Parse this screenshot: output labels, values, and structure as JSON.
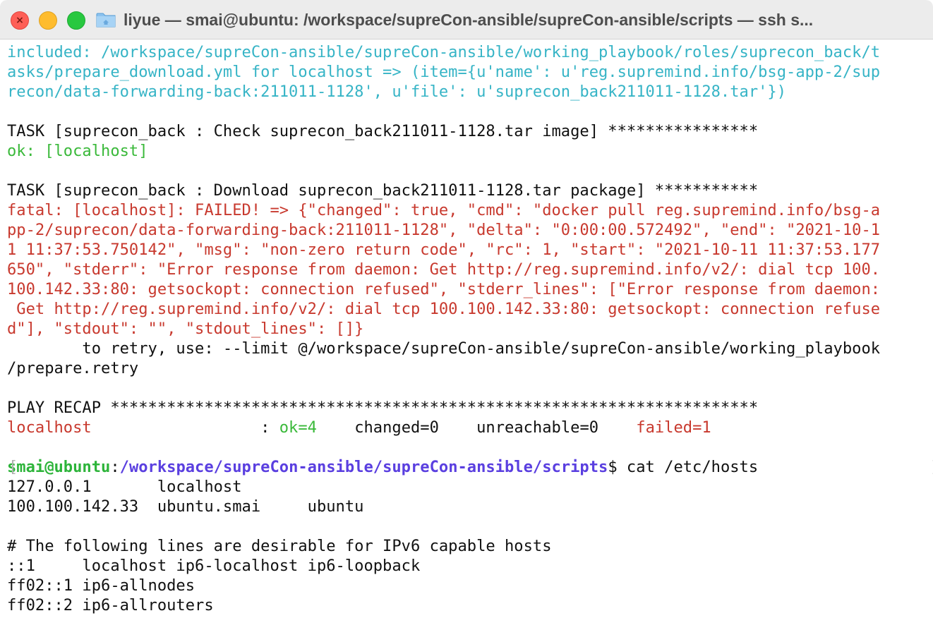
{
  "window": {
    "title": "liyue — smai@ubuntu: /workspace/supreCon-ansible/supreCon-ansible/scripts — ssh s...",
    "close_glyph": "×",
    "colors": {
      "close": "#fe5f57",
      "minimize": "#febc2e",
      "zoom": "#28c840"
    }
  },
  "terminal": {
    "included": [
      "included: /workspace/supreCon-ansible/supreCon-ansible/working_playbook/roles/suprecon_back/t",
      "asks/prepare_download.yml for localhost => (item={u'name': u'reg.supremind.info/bsg-app-2/sup",
      "recon/data-forwarding-back:211011-1128', u'file': u'suprecon_back211011-1128.tar'})"
    ],
    "task_check": "TASK [suprecon_back : Check suprecon_back211011-1128.tar image] ****************",
    "ok_line": "ok: [localhost]",
    "task_download": "TASK [suprecon_back : Download suprecon_back211011-1128.tar package] ***********",
    "fatal": [
      "fatal: [localhost]: FAILED! => {\"changed\": true, \"cmd\": \"docker pull reg.supremind.info/bsg-a",
      "pp-2/suprecon/data-forwarding-back:211011-1128\", \"delta\": \"0:00:00.572492\", \"end\": \"2021-10-1",
      "1 11:37:53.750142\", \"msg\": \"non-zero return code\", \"rc\": 1, \"start\": \"2021-10-11 11:37:53.177",
      "650\", \"stderr\": \"Error response from daemon: Get http://reg.supremind.info/v2/: dial tcp 100.",
      "100.142.33:80: getsockopt: connection refused\", \"stderr_lines\": [\"Error response from daemon:",
      " Get http://reg.supremind.info/v2/: dial tcp 100.100.142.33:80: getsockopt: connection refuse",
      "d\"], \"stdout\": \"\", \"stdout_lines\": []}"
    ],
    "retry": [
      "        to retry, use: --limit @/workspace/supreCon-ansible/supreCon-ansible/working_playbook",
      "/prepare.retry"
    ],
    "play_recap": "PLAY RECAP *********************************************************************",
    "recap": {
      "host": "localhost",
      "sep": "                  : ",
      "ok": "ok=4",
      "gap1": "    ",
      "changed": "changed=0",
      "gap2": "    ",
      "unreachable": "unreachable=0",
      "gap3": "    ",
      "failed": "failed=1"
    },
    "prompt": {
      "bracket_open": "[",
      "user": "smai@ubuntu",
      "colon": ":",
      "path": "/workspace/supreCon-ansible/supreCon-ansible/scripts",
      "command": "$ cat /etc/hosts",
      "bracket_close": "]"
    },
    "hosts": [
      "127.0.0.1       localhost",
      "100.100.142.33  ubuntu.smai     ubuntu",
      "",
      "# The following lines are desirable for IPv6 capable hosts",
      "::1     localhost ip6-localhost ip6-loopback",
      "ff02::1 ip6-allnodes",
      "ff02::2 ip6-allrouters"
    ]
  }
}
